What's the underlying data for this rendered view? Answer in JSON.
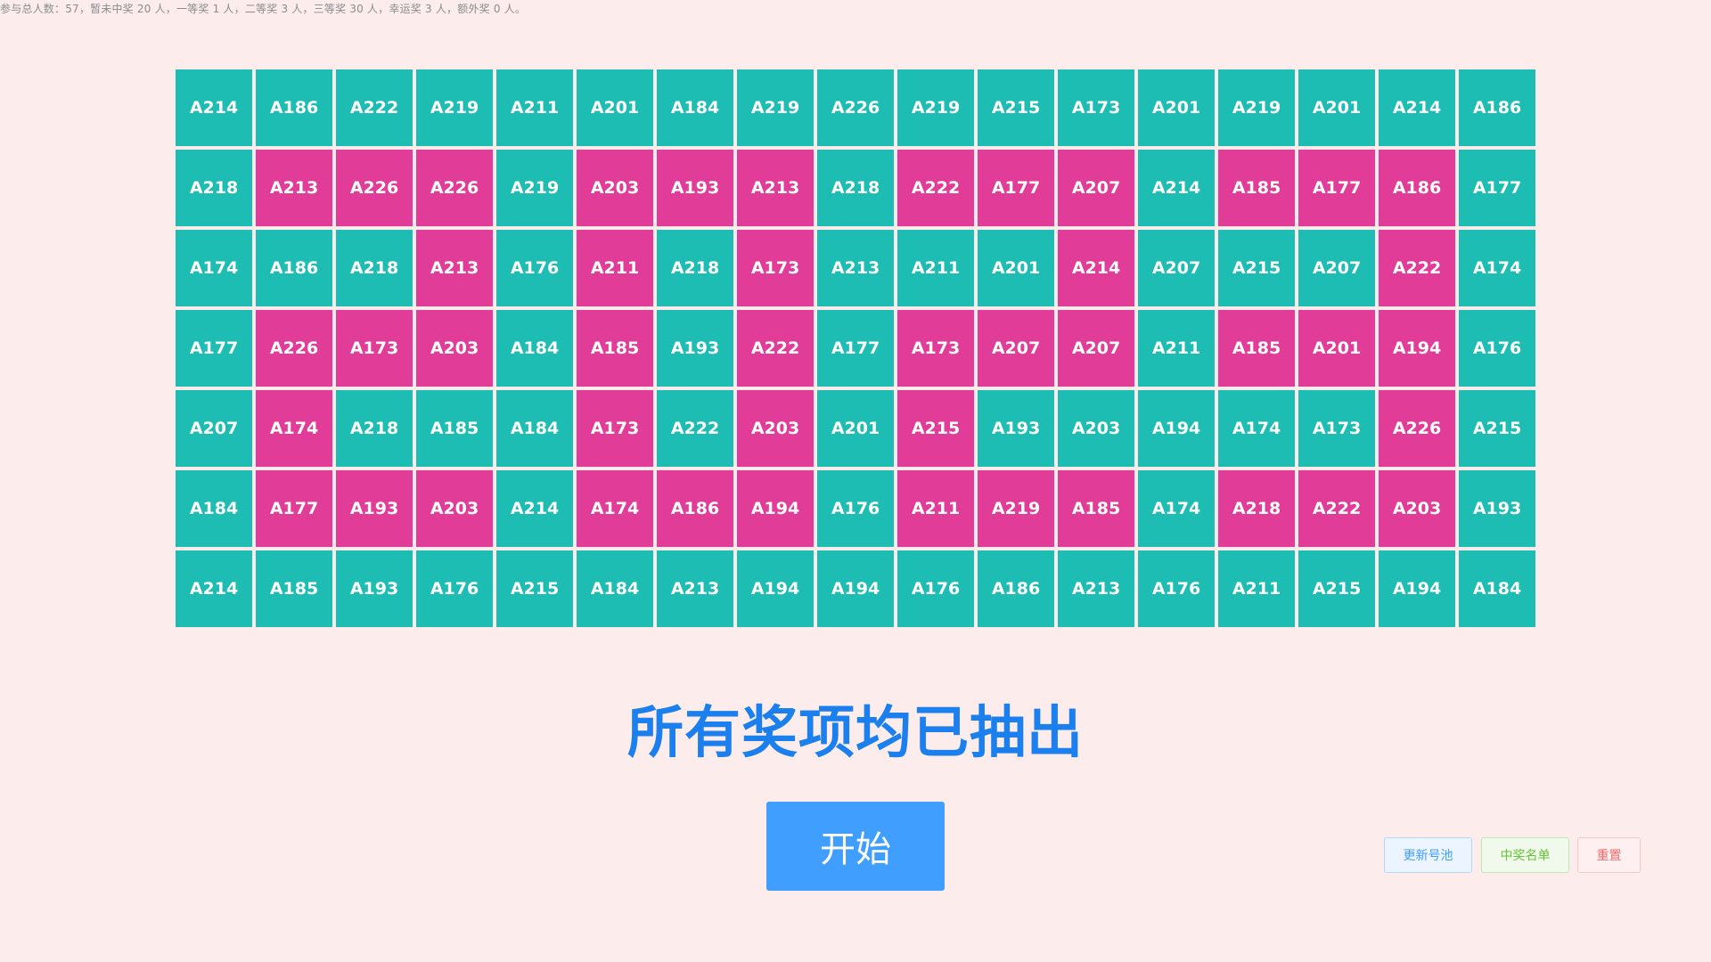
{
  "stats_text": "参与总人数：57，暂未中奖 20 人，一等奖 1 人，二等奖 3 人，三等奖 30 人，幸运奖 3 人，额外奖 0 人。",
  "colors": {
    "background": "#fcedec",
    "cell_teal": "#1dbdb3",
    "cell_pink": "#e23c99",
    "headline": "#1b80ee",
    "primary_button": "#409eff"
  },
  "grid": {
    "columns": 17,
    "rows": [
      [
        {
          "label": "A214",
          "color": "teal"
        },
        {
          "label": "A186",
          "color": "teal"
        },
        {
          "label": "A222",
          "color": "teal"
        },
        {
          "label": "A219",
          "color": "teal"
        },
        {
          "label": "A211",
          "color": "teal"
        },
        {
          "label": "A201",
          "color": "teal"
        },
        {
          "label": "A184",
          "color": "teal"
        },
        {
          "label": "A219",
          "color": "teal"
        },
        {
          "label": "A226",
          "color": "teal"
        },
        {
          "label": "A219",
          "color": "teal"
        },
        {
          "label": "A215",
          "color": "teal"
        },
        {
          "label": "A173",
          "color": "teal"
        },
        {
          "label": "A201",
          "color": "teal"
        },
        {
          "label": "A219",
          "color": "teal"
        },
        {
          "label": "A201",
          "color": "teal"
        },
        {
          "label": "A214",
          "color": "teal"
        },
        {
          "label": "A186",
          "color": "teal"
        }
      ],
      [
        {
          "label": "A218",
          "color": "teal"
        },
        {
          "label": "A213",
          "color": "pink"
        },
        {
          "label": "A226",
          "color": "pink"
        },
        {
          "label": "A226",
          "color": "pink"
        },
        {
          "label": "A219",
          "color": "teal"
        },
        {
          "label": "A203",
          "color": "pink"
        },
        {
          "label": "A193",
          "color": "pink"
        },
        {
          "label": "A213",
          "color": "pink"
        },
        {
          "label": "A218",
          "color": "teal"
        },
        {
          "label": "A222",
          "color": "pink"
        },
        {
          "label": "A177",
          "color": "pink"
        },
        {
          "label": "A207",
          "color": "pink"
        },
        {
          "label": "A214",
          "color": "teal"
        },
        {
          "label": "A185",
          "color": "pink"
        },
        {
          "label": "A177",
          "color": "pink"
        },
        {
          "label": "A186",
          "color": "pink"
        },
        {
          "label": "A177",
          "color": "teal"
        }
      ],
      [
        {
          "label": "A174",
          "color": "teal"
        },
        {
          "label": "A186",
          "color": "teal"
        },
        {
          "label": "A218",
          "color": "teal"
        },
        {
          "label": "A213",
          "color": "pink"
        },
        {
          "label": "A176",
          "color": "teal"
        },
        {
          "label": "A211",
          "color": "pink"
        },
        {
          "label": "A218",
          "color": "teal"
        },
        {
          "label": "A173",
          "color": "pink"
        },
        {
          "label": "A213",
          "color": "teal"
        },
        {
          "label": "A211",
          "color": "teal"
        },
        {
          "label": "A201",
          "color": "teal"
        },
        {
          "label": "A214",
          "color": "pink"
        },
        {
          "label": "A207",
          "color": "teal"
        },
        {
          "label": "A215",
          "color": "teal"
        },
        {
          "label": "A207",
          "color": "teal"
        },
        {
          "label": "A222",
          "color": "pink"
        },
        {
          "label": "A174",
          "color": "teal"
        }
      ],
      [
        {
          "label": "A177",
          "color": "teal"
        },
        {
          "label": "A226",
          "color": "pink"
        },
        {
          "label": "A173",
          "color": "pink"
        },
        {
          "label": "A203",
          "color": "pink"
        },
        {
          "label": "A184",
          "color": "teal"
        },
        {
          "label": "A185",
          "color": "pink"
        },
        {
          "label": "A193",
          "color": "teal"
        },
        {
          "label": "A222",
          "color": "pink"
        },
        {
          "label": "A177",
          "color": "teal"
        },
        {
          "label": "A173",
          "color": "pink"
        },
        {
          "label": "A207",
          "color": "pink"
        },
        {
          "label": "A207",
          "color": "pink"
        },
        {
          "label": "A211",
          "color": "teal"
        },
        {
          "label": "A185",
          "color": "pink"
        },
        {
          "label": "A201",
          "color": "pink"
        },
        {
          "label": "A194",
          "color": "pink"
        },
        {
          "label": "A176",
          "color": "teal"
        }
      ],
      [
        {
          "label": "A207",
          "color": "teal"
        },
        {
          "label": "A174",
          "color": "pink"
        },
        {
          "label": "A218",
          "color": "teal"
        },
        {
          "label": "A185",
          "color": "teal"
        },
        {
          "label": "A184",
          "color": "teal"
        },
        {
          "label": "A173",
          "color": "pink"
        },
        {
          "label": "A222",
          "color": "teal"
        },
        {
          "label": "A203",
          "color": "pink"
        },
        {
          "label": "A201",
          "color": "teal"
        },
        {
          "label": "A215",
          "color": "pink"
        },
        {
          "label": "A193",
          "color": "teal"
        },
        {
          "label": "A203",
          "color": "teal"
        },
        {
          "label": "A194",
          "color": "teal"
        },
        {
          "label": "A174",
          "color": "teal"
        },
        {
          "label": "A173",
          "color": "teal"
        },
        {
          "label": "A226",
          "color": "pink"
        },
        {
          "label": "A215",
          "color": "teal"
        }
      ],
      [
        {
          "label": "A184",
          "color": "teal"
        },
        {
          "label": "A177",
          "color": "pink"
        },
        {
          "label": "A193",
          "color": "pink"
        },
        {
          "label": "A203",
          "color": "pink"
        },
        {
          "label": "A214",
          "color": "teal"
        },
        {
          "label": "A174",
          "color": "pink"
        },
        {
          "label": "A186",
          "color": "pink"
        },
        {
          "label": "A194",
          "color": "pink"
        },
        {
          "label": "A176",
          "color": "teal"
        },
        {
          "label": "A211",
          "color": "pink"
        },
        {
          "label": "A219",
          "color": "pink"
        },
        {
          "label": "A185",
          "color": "pink"
        },
        {
          "label": "A174",
          "color": "teal"
        },
        {
          "label": "A218",
          "color": "pink"
        },
        {
          "label": "A222",
          "color": "pink"
        },
        {
          "label": "A203",
          "color": "pink"
        },
        {
          "label": "A193",
          "color": "teal"
        }
      ],
      [
        {
          "label": "A214",
          "color": "teal"
        },
        {
          "label": "A185",
          "color": "teal"
        },
        {
          "label": "A193",
          "color": "teal"
        },
        {
          "label": "A176",
          "color": "teal"
        },
        {
          "label": "A215",
          "color": "teal"
        },
        {
          "label": "A184",
          "color": "teal"
        },
        {
          "label": "A213",
          "color": "teal"
        },
        {
          "label": "A194",
          "color": "teal"
        },
        {
          "label": "A194",
          "color": "teal"
        },
        {
          "label": "A176",
          "color": "teal"
        },
        {
          "label": "A186",
          "color": "teal"
        },
        {
          "label": "A213",
          "color": "teal"
        },
        {
          "label": "A176",
          "color": "teal"
        },
        {
          "label": "A211",
          "color": "teal"
        },
        {
          "label": "A215",
          "color": "teal"
        },
        {
          "label": "A194",
          "color": "teal"
        },
        {
          "label": "A184",
          "color": "teal"
        }
      ]
    ]
  },
  "headline": "所有奖项均已抽出",
  "buttons": {
    "start": "开始",
    "update_pool": "更新号池",
    "winners_list": "中奖名单",
    "reset": "重置"
  }
}
